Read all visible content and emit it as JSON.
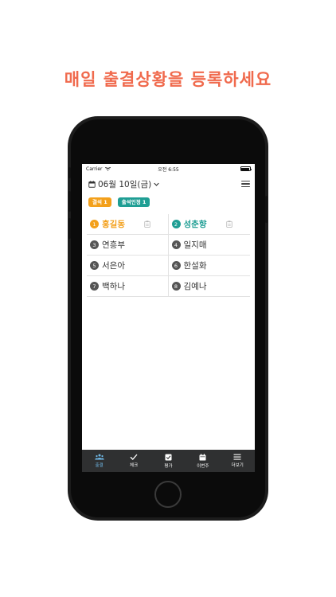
{
  "headline": "매일 출결상황을 등록하세요",
  "status_bar": {
    "carrier": "Carrier",
    "time": "오전 6:55"
  },
  "header": {
    "date": "06월 10일(금)"
  },
  "badges": [
    {
      "label": "결석 1",
      "color": "#f3a01b"
    },
    {
      "label": "출석인정 1",
      "color": "#1f9e94"
    }
  ],
  "students": [
    {
      "no": "1",
      "name": "홍길동",
      "status": "absent"
    },
    {
      "no": "2",
      "name": "성춘향",
      "status": "excused"
    },
    {
      "no": "3",
      "name": "연흥부",
      "status": "none"
    },
    {
      "no": "4",
      "name": "일지매",
      "status": "none"
    },
    {
      "no": "5",
      "name": "서은아",
      "status": "none"
    },
    {
      "no": "6",
      "name": "한설화",
      "status": "none"
    },
    {
      "no": "7",
      "name": "백하나",
      "status": "none"
    },
    {
      "no": "8",
      "name": "김예나",
      "status": "none"
    }
  ],
  "tabs": [
    {
      "label": "출결",
      "icon": "people-icon",
      "active": true
    },
    {
      "label": "체크",
      "icon": "check-icon",
      "active": false
    },
    {
      "label": "평가",
      "icon": "checkbox-icon",
      "active": false
    },
    {
      "label": "이번주",
      "icon": "calendar-icon",
      "active": false
    },
    {
      "label": "더보기",
      "icon": "menu-icon",
      "active": false
    }
  ],
  "colors": {
    "headline": "#f06a4d",
    "absent": "#f3a01b",
    "excused": "#1f9e94",
    "tabbar": "#2f3031",
    "tab_active": "#6fb8e6"
  }
}
